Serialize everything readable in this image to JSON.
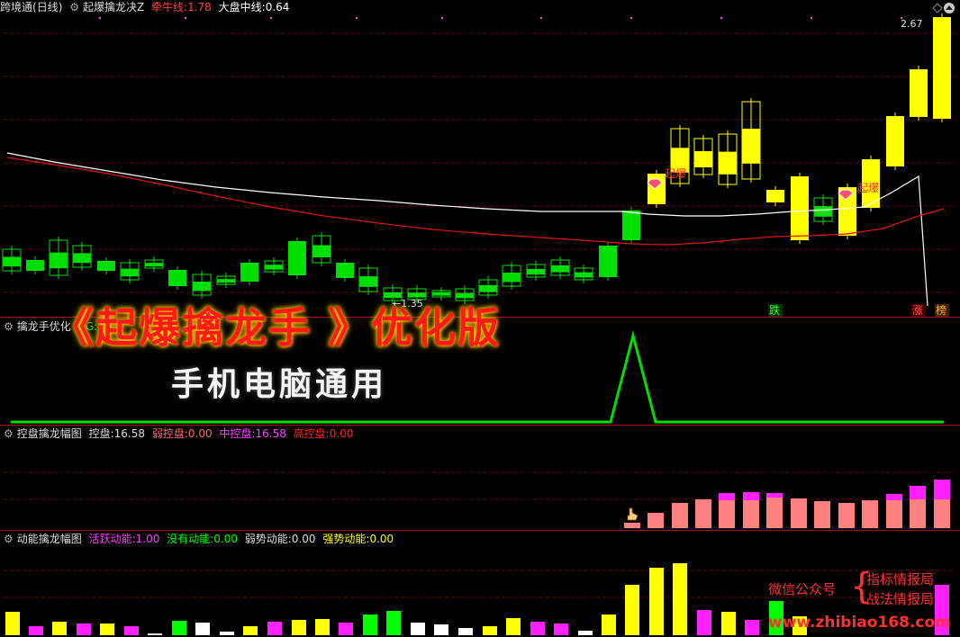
{
  "main_panel": {
    "stock_name": "跨境通",
    "period": "(日线)",
    "indicator_name": "起爆擒龙决Z",
    "bull_line_label": "牵牛线:",
    "bull_line_value": "1.78",
    "market_line_label": "大盘中线:",
    "market_line_value": "0.64",
    "price_high_label": "2.67",
    "price_low_label": "1.35",
    "signal_labels": [
      "起爆",
      "起爆"
    ],
    "bottom_markers": [
      "跌",
      "涨",
      "榜"
    ],
    "colors": {
      "up_red": "#ff2020",
      "down_green": "#00e000",
      "yellow": "#ffff00",
      "white_line": "#ffffff",
      "red_line": "#ff2020"
    }
  },
  "panel2": {
    "title": "擒龙手优化",
    "xg_label": "XG:",
    "colors": {
      "line": "#00e000"
    }
  },
  "panel3": {
    "title": "控盘擒龙幅图",
    "items": [
      {
        "label": "控盘:",
        "value": "16.58",
        "color": "#dddddd"
      },
      {
        "label": "弱控盘:",
        "value": "0.00",
        "color": "#ff6a6a"
      },
      {
        "label": "中控盘:",
        "value": "16.58",
        "color": "#ff40ff"
      },
      {
        "label": "高控盘:",
        "value": "0.00",
        "color": "#ff2020"
      }
    ]
  },
  "panel4": {
    "title": "动能擒龙幅图",
    "items": [
      {
        "label": "活跃动能:",
        "value": "1.00",
        "color": "#ff40ff"
      },
      {
        "label": "没有动能:",
        "value": "0.00",
        "color": "#00ff00"
      },
      {
        "label": "弱势动能:",
        "value": "0.00",
        "color": "#dddddd"
      },
      {
        "label": "强势动能:",
        "value": "0.00",
        "color": "#ffff00"
      }
    ]
  },
  "overlay": {
    "banner_text": "《起爆擒龙手 》优化版",
    "sub_text": "手机电脑通用",
    "wechat_label": "微信公众号",
    "account_1": "指标情报局",
    "account_2": "战法情报局",
    "website": "www.zhibiao168.com"
  }
}
